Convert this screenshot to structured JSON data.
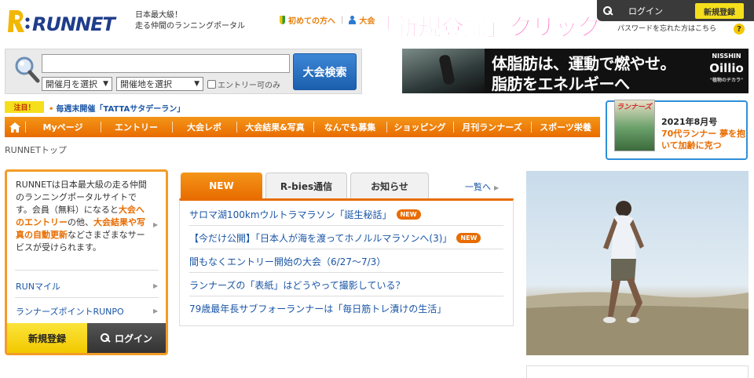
{
  "header": {
    "tagline": [
      "日本最大級！",
      "走る仲間のランニングポータル"
    ],
    "links": [
      "初めての方へ",
      "大会"
    ],
    "login_label": "ログイン",
    "register_label": "新規登録",
    "forgot_text": "パスワードを忘れた方はこちら",
    "overlay_text": "「新規登録」クリック"
  },
  "search": {
    "input_value": "",
    "month_select": "開催月を選択",
    "place_select": "開催地を選択",
    "entry_checkbox_label": "エントリー可のみ",
    "button_label": "大会検索"
  },
  "ad": {
    "line1": "体脂肪は、運動で燃やせ。",
    "line2": "脂肪をエネルギーへ",
    "brand_top": "NISSHIN",
    "brand_name": "Oillio",
    "brand_tag": "\"植物のチカラ\""
  },
  "notice": {
    "badge": "注目！",
    "text": "毎週末開催「TATTAサタデーラン」"
  },
  "nav": {
    "items": [
      "Myページ",
      "エントリー",
      "大会レポ",
      "大会結果&写真",
      "なんでも募集",
      "ショッピング",
      "月刊ランナーズ",
      "スポーツ栄養"
    ]
  },
  "magazine": {
    "logo": "ランナーズ",
    "issue": "2021年8月号",
    "headline": "70代ランナー 夢を抱いて加齢に克つ"
  },
  "breadcrumb": "RUNNETトップ",
  "side": {
    "desc_1": "RUNNETは日本最大級の走る仲間のランニングポータルサイトです。会員（無料）になると",
    "desc_b1": "大会へのエントリー",
    "desc_2": "の他、",
    "desc_b2": "大会結果や写真の自動更新",
    "desc_3": "などさまざまなサービスが受けられます。",
    "link_miles": "RUNマイル",
    "link_points": "ランナーズポイントRUNPO",
    "register_button": "新規登録",
    "login_button": "ログイン"
  },
  "news": {
    "tabs": [
      "NEW",
      "R-bies通信",
      "お知らせ"
    ],
    "more_label": "一覧へ",
    "new_badge": "NEW",
    "items": [
      {
        "title": "サロマ湖100kmウルトラマラソン「誕生秘話」",
        "is_new": true
      },
      {
        "title": "【今だけ公開】「日本人が海を渡ってホノルルマラソンへ(3)」",
        "is_new": true
      },
      {
        "title": "間もなくエントリー開始の大会（6/27～7/3）",
        "is_new": false
      },
      {
        "title": "ランナーズの「表紙」はどうやって撮影している？",
        "is_new": false
      },
      {
        "title": "79歳最年長サブフォーランナーは「毎日筋トレ漬けの生活」",
        "is_new": false
      }
    ]
  },
  "colors": {
    "accent_orange": "#e86c00",
    "link_blue": "#1a55a6",
    "yellow": "#f5df1c",
    "overlay_pink": "#ff1ea0"
  }
}
